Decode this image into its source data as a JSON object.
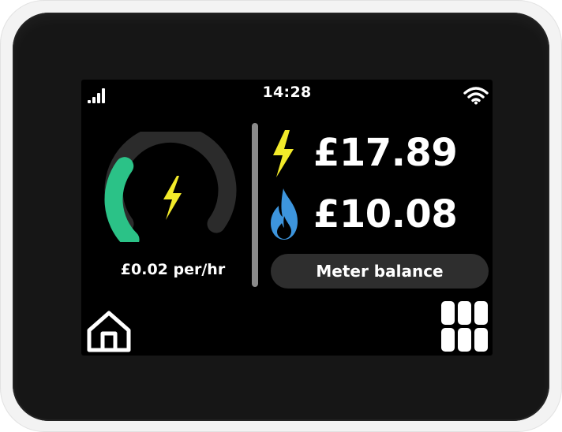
{
  "status_bar": {
    "time": "14:28",
    "signal_icon": "signal-bars-icon",
    "wifi_icon": "wifi-icon"
  },
  "usage_gauge": {
    "rate_text": "£0.02 per/hr",
    "level_fraction": 0.3,
    "fuel_icon": "lightning-bolt-icon",
    "colors": {
      "level": "#2bc287",
      "track": "#2b2b2b",
      "bolt": "#f2ea2a"
    }
  },
  "balances": {
    "electricity": {
      "value": "£17.89",
      "icon": "lightning-bolt-icon",
      "color": "#f2ea2a"
    },
    "gas": {
      "value": "£10.08",
      "icon": "gas-flame-icon",
      "color": "#3d95dd"
    }
  },
  "meter_balance_button": {
    "label": "Meter balance"
  },
  "nav": {
    "home_icon": "home-icon",
    "apps_icon": "apps-grid-icon"
  }
}
